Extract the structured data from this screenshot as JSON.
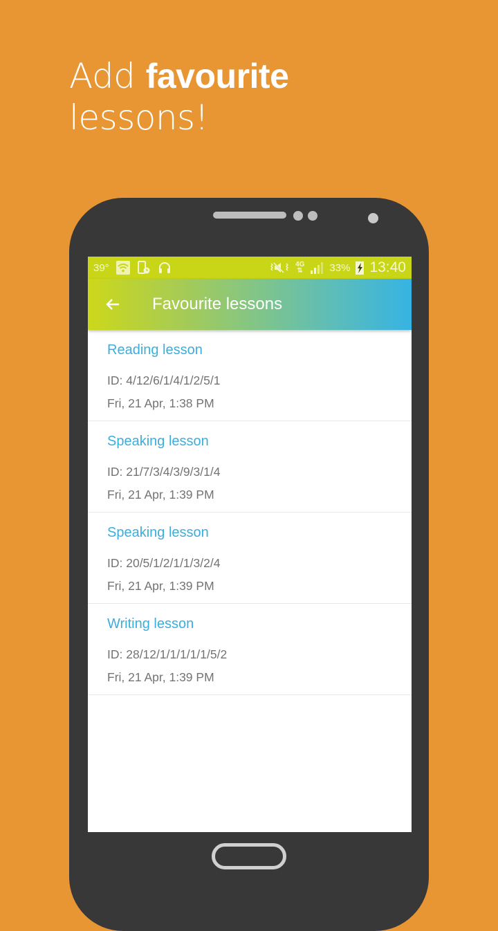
{
  "promo": {
    "line1_light": "Add",
    "line1_bold": "favourite",
    "line2": "lessons!"
  },
  "colors": {
    "background": "#E89534",
    "phone_body": "#383838",
    "status_bar": "#C8D617",
    "appbar_gradient_start": "#CCD81A",
    "appbar_gradient_end": "#36B3E3",
    "lesson_title": "#3AAEDC",
    "secondary_text": "#737373"
  },
  "status_bar": {
    "temperature": "39°",
    "icons_left": [
      "wifi-icon",
      "device-schedule-icon",
      "headphones-icon"
    ],
    "icons_right": [
      "vibrate-mute-icon",
      "network-4g-icon",
      "signal-icon",
      "battery-charging-icon"
    ],
    "network_label": "4G",
    "battery": "33%",
    "time": "13:40"
  },
  "appbar": {
    "back_icon": "arrow-left-icon",
    "title": "Favourite lessons"
  },
  "lessons": [
    {
      "title": "Reading lesson",
      "id": "ID: 4/12/6/1/4/1/2/5/1",
      "date": "Fri, 21 Apr, 1:38 PM"
    },
    {
      "title": "Speaking lesson",
      "id": "ID: 21/7/3/4/3/9/3/1/4",
      "date": "Fri, 21 Apr, 1:39 PM"
    },
    {
      "title": "Speaking lesson",
      "id": "ID: 20/5/1/2/1/1/3/2/4",
      "date": "Fri, 21 Apr, 1:39 PM"
    },
    {
      "title": "Writing lesson",
      "id": "ID: 28/12/1/1/1/1/1/5/2",
      "date": "Fri, 21 Apr, 1:39 PM"
    }
  ]
}
